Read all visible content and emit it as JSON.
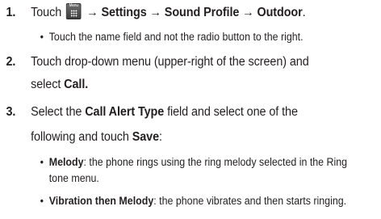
{
  "steps": [
    {
      "number": "1.",
      "pre": "Touch",
      "icon": {
        "name": "menu-icon",
        "label": "Menu"
      },
      "path": [
        {
          "sep": "→",
          "item": "Settings"
        },
        {
          "sep": "→",
          "item": "Sound Profile"
        },
        {
          "sep": "→",
          "item": "Outdoor"
        }
      ],
      "end": "."
    },
    {
      "number": "2.",
      "line1": "Touch drop-down menu (upper-right of the screen) and",
      "line2_pre": "select",
      "line2_bold": "Call."
    },
    {
      "number": "3.",
      "line1_pre": "Select the",
      "line1_bold": "Call Alert Type",
      "line1_post": "field and select one of the",
      "line2_pre": "following and touch",
      "line2_bold": "Save",
      "line2_post": ":"
    }
  ],
  "bullets": [
    {
      "text": "Touch the name field and not the radio button to the right."
    },
    {
      "bold": "Melody",
      "text_line1": ": the phone rings using the ring melody selected in the Ring",
      "text_line2": "tone menu."
    },
    {
      "bold": "Vibration then Melody",
      "text": ": the phone vibrates and then starts ringing."
    }
  ]
}
